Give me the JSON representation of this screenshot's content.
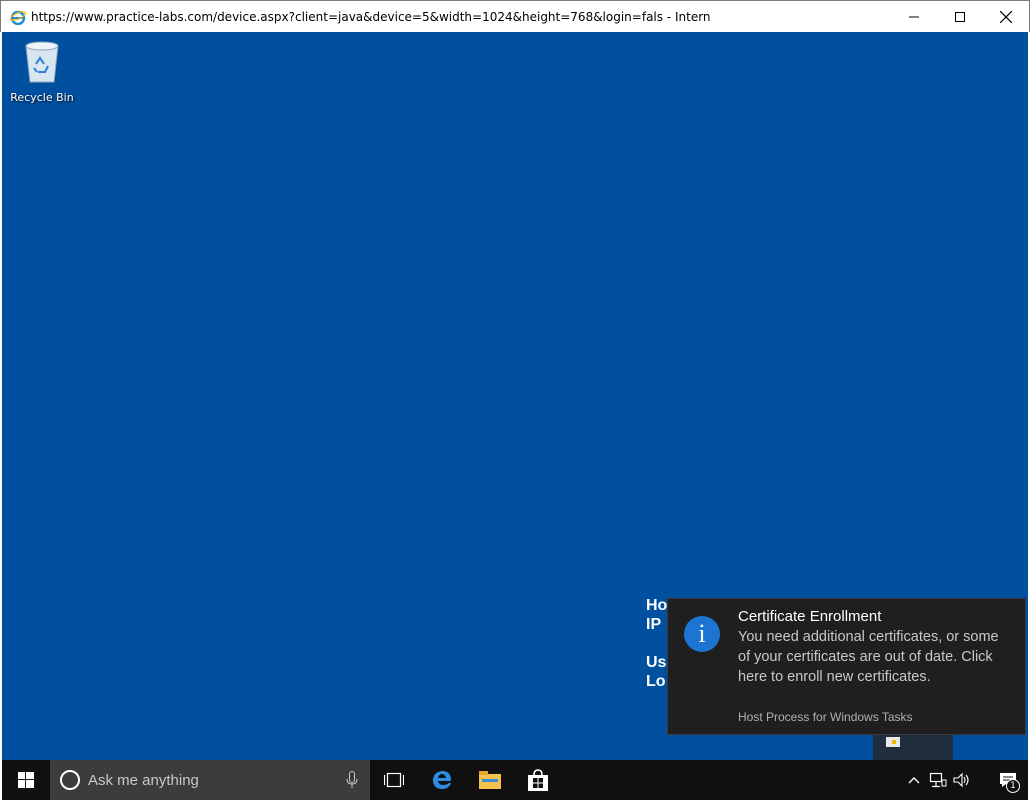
{
  "window": {
    "title": "https://www.practice-labs.com/device.aspx?client=java&device=5&width=1024&height=768&login=fals - Internet Explorer",
    "app_icon": "internet-explorer-icon",
    "controls": [
      "minimize-icon",
      "maximize-icon",
      "close-icon"
    ]
  },
  "desktop": {
    "background_color": "#0150a0",
    "icons": [
      {
        "label": "Recycle Bin",
        "icon": "recycle-bin-icon"
      }
    ],
    "bginfo_lines": [
      "Ho",
      "IP",
      "",
      "Us",
      "Lo"
    ]
  },
  "toast": {
    "icon": "info-icon",
    "icon_glyph": "i",
    "title": "Certificate Enrollment",
    "body": "You need additional certificates, or some of your certificates are out of date.  Click here to enroll new certificates.",
    "source": "Host Process for Windows Tasks",
    "accent_color": "#1c75d2"
  },
  "taskbar": {
    "search_placeholder": "Ask me anything",
    "pinned": [
      "task-view-icon",
      "edge-icon",
      "file-explorer-icon",
      "store-icon"
    ],
    "tray": [
      "chevron-up-icon",
      "network-icon",
      "volume-icon"
    ],
    "action_center_badge": "1"
  }
}
